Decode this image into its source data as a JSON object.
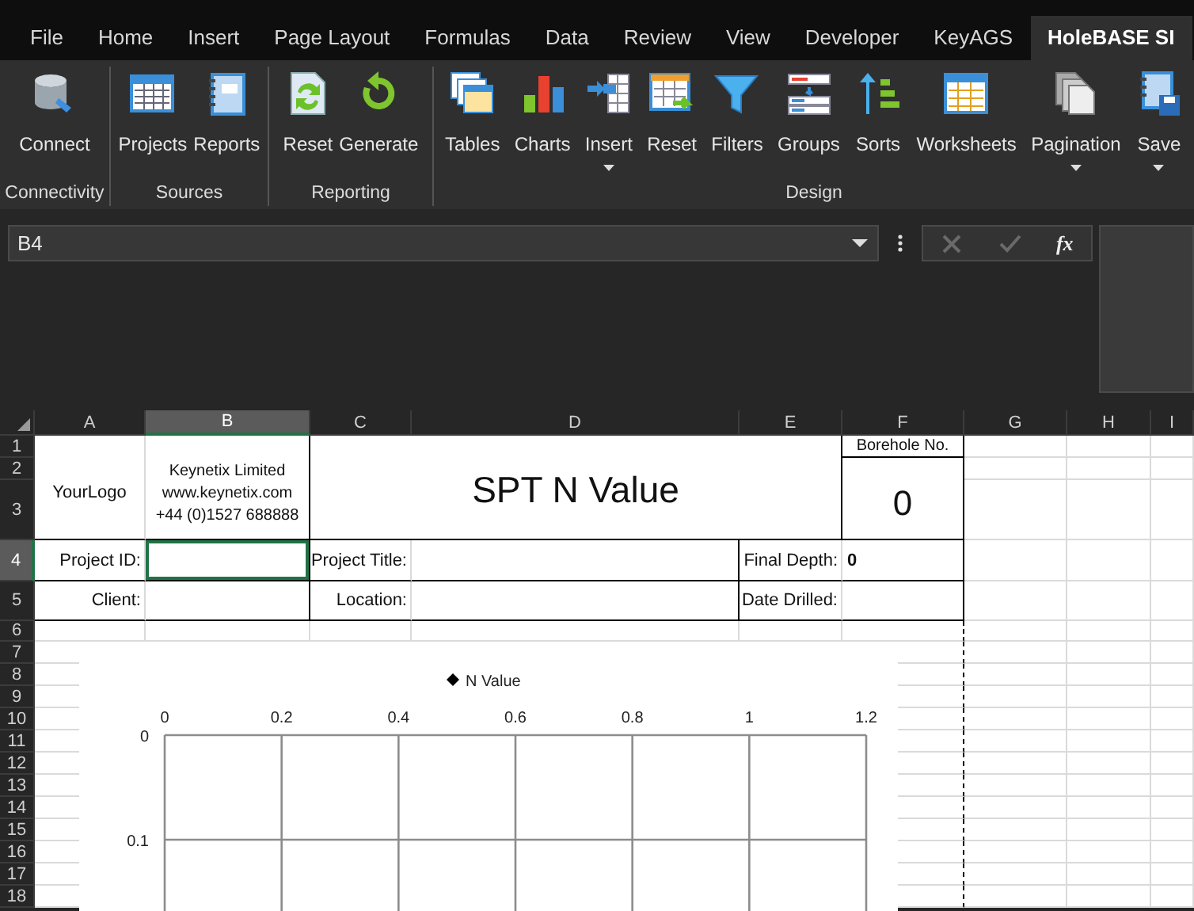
{
  "tabs": [
    {
      "label": "File",
      "selected": false
    },
    {
      "label": "Home",
      "selected": false
    },
    {
      "label": "Insert",
      "selected": false
    },
    {
      "label": "Page Layout",
      "selected": false
    },
    {
      "label": "Formulas",
      "selected": false
    },
    {
      "label": "Data",
      "selected": false
    },
    {
      "label": "Review",
      "selected": false
    },
    {
      "label": "View",
      "selected": false
    },
    {
      "label": "Developer",
      "selected": false
    },
    {
      "label": "KeyAGS",
      "selected": false
    },
    {
      "label": "HoleBASE SI",
      "selected": true
    }
  ],
  "ribbon": {
    "groups": [
      {
        "label": "Connectivity",
        "buttons": [
          {
            "label": "Connect",
            "menu": false
          }
        ]
      },
      {
        "label": "Sources",
        "buttons": [
          {
            "label": "Projects",
            "menu": false
          },
          {
            "label": "Reports",
            "menu": false
          }
        ]
      },
      {
        "label": "Reporting",
        "buttons": [
          {
            "label": "Reset",
            "menu": false
          },
          {
            "label": "Generate",
            "menu": false
          }
        ]
      },
      {
        "label": "Design",
        "buttons": [
          {
            "label": "Tables",
            "menu": false
          },
          {
            "label": "Charts",
            "menu": false
          },
          {
            "label": "Insert",
            "menu": true
          },
          {
            "label": "Reset",
            "menu": false
          },
          {
            "label": "Filters",
            "menu": false
          },
          {
            "label": "Groups",
            "menu": false
          },
          {
            "label": "Sorts",
            "menu": false
          },
          {
            "label": "Worksheets",
            "menu": false
          },
          {
            "label": "Pagination",
            "menu": true
          },
          {
            "label": "Save",
            "menu": true
          }
        ]
      }
    ]
  },
  "formula_bar": {
    "name_box": "B4",
    "cancel": {
      "disabled": true
    },
    "enter": {
      "disabled": true
    },
    "function_button": "fx"
  },
  "sheet": {
    "columns": [
      {
        "label": "A",
        "selected": false
      },
      {
        "label": "B",
        "selected": true
      },
      {
        "label": "C",
        "selected": false
      },
      {
        "label": "D",
        "selected": false
      },
      {
        "label": "E",
        "selected": false
      },
      {
        "label": "F",
        "selected": false
      },
      {
        "label": "G",
        "selected": false
      },
      {
        "label": "H",
        "selected": false
      },
      {
        "label": "I",
        "selected": false
      }
    ],
    "rows": [
      {
        "label": "1",
        "selected": false
      },
      {
        "label": "2",
        "selected": false
      },
      {
        "label": "3",
        "selected": false
      },
      {
        "label": "4",
        "selected": true
      },
      {
        "label": "5",
        "selected": false
      },
      {
        "label": "6",
        "selected": false
      },
      {
        "label": "7",
        "selected": false
      },
      {
        "label": "8",
        "selected": false
      },
      {
        "label": "9",
        "selected": false
      },
      {
        "label": "10",
        "selected": false
      },
      {
        "label": "11",
        "selected": false
      },
      {
        "label": "12",
        "selected": false
      },
      {
        "label": "13",
        "selected": false
      },
      {
        "label": "14",
        "selected": false
      },
      {
        "label": "15",
        "selected": false
      },
      {
        "label": "16",
        "selected": false
      },
      {
        "label": "17",
        "selected": false
      },
      {
        "label": "18",
        "selected": false
      }
    ],
    "header": {
      "logo": "YourLogo",
      "company_lines": [
        "Keynetix Limited",
        "www.keynetix.com",
        "+44 (0)1527 688888"
      ],
      "title": "SPT N Value",
      "borehole_label": "Borehole No.",
      "borehole_value": "0"
    },
    "fields": [
      {
        "label": "Project ID:",
        "selected": true
      },
      {
        "label": "Project Title:",
        "selected": false
      },
      {
        "label": "Final Depth:",
        "value": "0",
        "selected": false
      },
      {
        "label": "Client:",
        "selected": false
      },
      {
        "label": "Location:",
        "selected": false
      },
      {
        "label": "Date Drilled:",
        "selected": false
      }
    ],
    "chart": {
      "legend": "N Value",
      "x_tick_labels": [
        "0",
        "0.2",
        "0.4",
        "0.6",
        "0.8",
        "1",
        "1.2"
      ],
      "y_tick_labels": [
        "0",
        "0.1"
      ]
    }
  }
}
